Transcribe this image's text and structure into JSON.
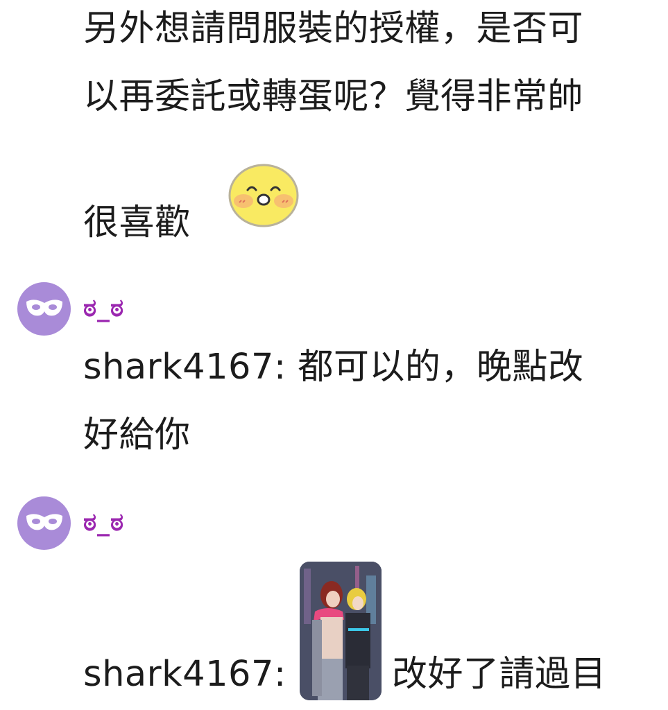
{
  "messages": [
    {
      "lines": [
        "另外想請問服裝的授權，是否可",
        "以再委託或轉蛋呢？覺得非常帥",
        "很喜歡"
      ],
      "sticker": "blushing-smile-emoji"
    },
    {
      "avatar_icon": "mask-icon",
      "username": "ಠ_ಠ",
      "lines": [
        "shark4167: 都可以的，晚點改",
        "好給你"
      ]
    },
    {
      "avatar_icon": "mask-icon",
      "username": "ಠ_ಠ",
      "prefix": "shark4167:",
      "attachment": "anime-character-image",
      "suffix": "改好了請過目"
    }
  ],
  "colors": {
    "avatar_bg": "#a98bd8",
    "username": "#9b27b0",
    "text": "#1c1c1c"
  }
}
